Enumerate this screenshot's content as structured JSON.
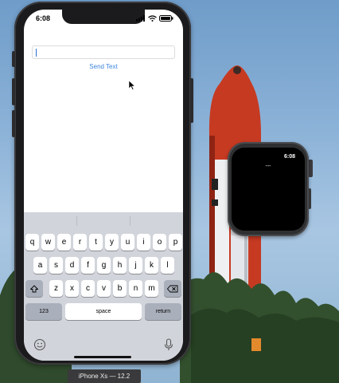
{
  "phone": {
    "status_time": "6:08",
    "text_field": {
      "value": "",
      "placeholder": ""
    },
    "send_button_label": "Send Text",
    "keyboard": {
      "row1": [
        "q",
        "w",
        "e",
        "r",
        "t",
        "y",
        "u",
        "i",
        "o",
        "p"
      ],
      "row2": [
        "a",
        "s",
        "d",
        "f",
        "g",
        "h",
        "j",
        "k",
        "l"
      ],
      "row3": [
        "z",
        "x",
        "c",
        "v",
        "b",
        "n",
        "m"
      ],
      "numbers_label": "123",
      "space_label": "space",
      "return_label": "return"
    }
  },
  "watch": {
    "status_time": "6:08",
    "label_text": "---"
  },
  "simulator_label": "iPhone Xs — 12.2",
  "colors": {
    "accent": "#3d86e0",
    "keyboard_bg": "#d1d4db",
    "rocket_red": "#c63a22"
  }
}
